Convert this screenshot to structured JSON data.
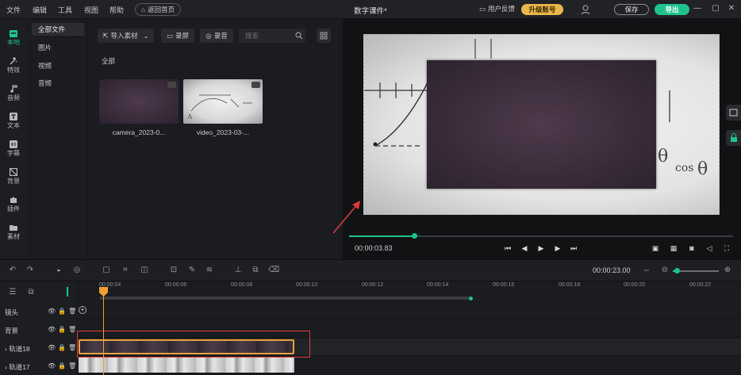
{
  "menu": [
    "文件",
    "编辑",
    "工具",
    "视图",
    "帮助"
  ],
  "home_button": "返回首页",
  "title": "数字课件*",
  "feedback": "用户反馈",
  "upgrade": "升级账号",
  "save": "保存",
  "export": "导出",
  "rail": [
    "本地",
    "特效",
    "音频",
    "文本",
    "字幕",
    "背景",
    "插件",
    "素材"
  ],
  "categories": [
    "全部文件",
    "图片",
    "视频",
    "音频"
  ],
  "media_toolbar": {
    "import": "导入素材",
    "record_screen": "录屏",
    "record_audio": "录音",
    "search_placeholder": "搜索"
  },
  "all_label": "全部",
  "media_items": [
    {
      "caption": "camera_2023-0..."
    },
    {
      "caption": "video_2023-03-..."
    }
  ],
  "preview": {
    "current_time": "00:00:03.83",
    "progress": 0.17
  },
  "timeline": {
    "total_time": "00:00:23.00",
    "ticks": [
      "00:00:04",
      "00:00:06",
      "00:00:08",
      "00:00:10",
      "00:00:12",
      "00:00:14",
      "00:00:16",
      "00:00:18",
      "00:00:20",
      "00:00:22"
    ],
    "tracks": [
      "镜头",
      "背景",
      "轨道18",
      "轨道17"
    ]
  },
  "colors": {
    "accent": "#1fc28d",
    "upgrade": "#e8b64c",
    "playhead": "#f0a030",
    "highlight": "#e03b3b"
  }
}
